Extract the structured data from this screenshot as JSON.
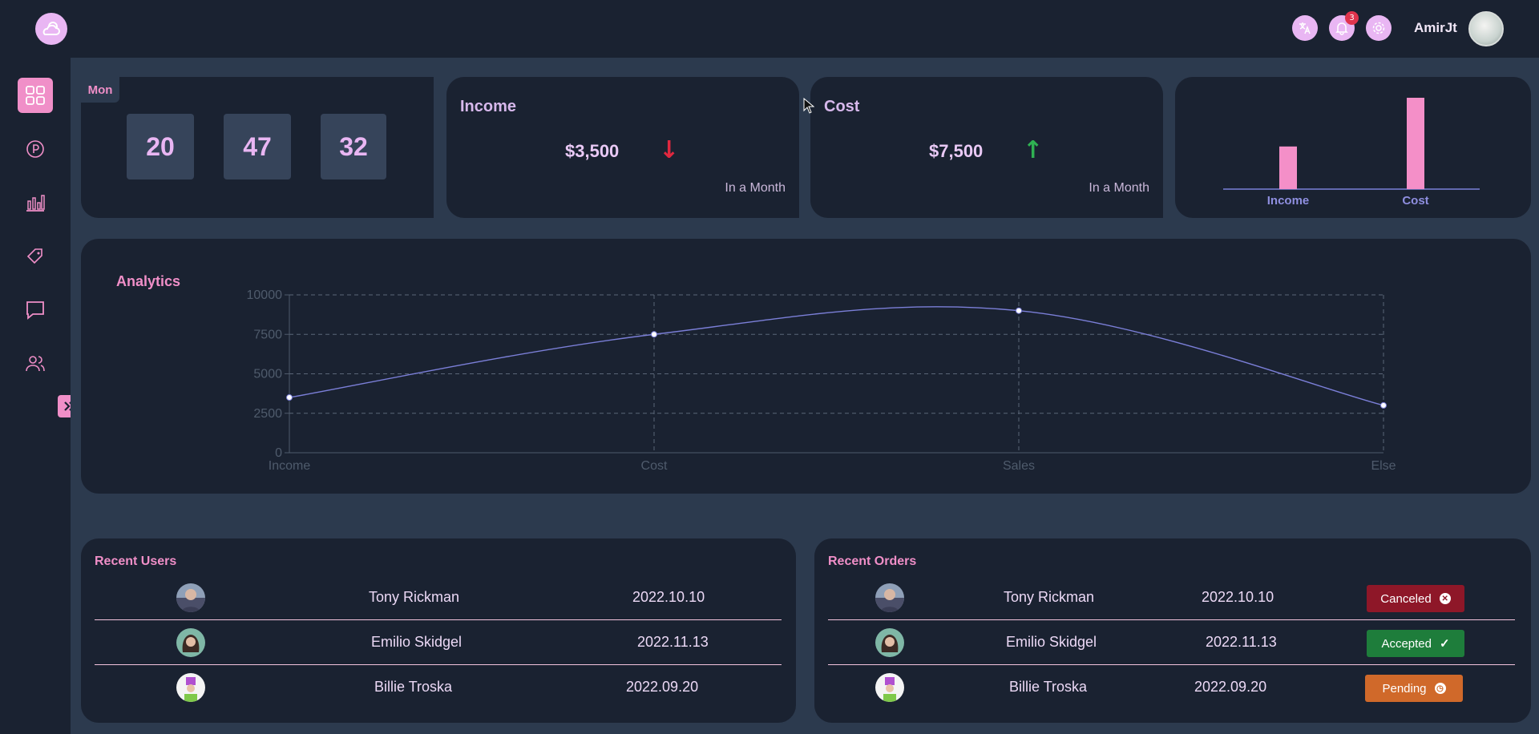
{
  "header": {
    "username": "AmirJt",
    "notification_count": "3",
    "icons": [
      "weather-logo-icon",
      "translate-icon",
      "bell-icon",
      "gear-icon"
    ]
  },
  "sidebar": {
    "items": [
      {
        "icon": "dashboard-grid-icon",
        "active": true
      },
      {
        "icon": "parking-icon",
        "active": false
      },
      {
        "icon": "bar-chart-icon",
        "active": false
      },
      {
        "icon": "tag-icon",
        "active": false
      },
      {
        "icon": "chat-icon",
        "active": false
      },
      {
        "icon": "users-icon",
        "active": false
      }
    ],
    "toggle_icon": "double-chevron-right-icon"
  },
  "clock": {
    "day": "Mon",
    "hours": "20",
    "minutes": "47",
    "seconds": "32"
  },
  "income_card": {
    "title": "Income",
    "amount": "$3,500",
    "trend": "down",
    "period": "In a Month"
  },
  "cost_card": {
    "title": "Cost",
    "amount": "$7,500",
    "trend": "up",
    "period": "In a Month"
  },
  "mini_chart": {
    "chart_data": {
      "type": "bar",
      "categories": [
        "Income",
        "Cost"
      ],
      "values": [
        3500,
        7500
      ],
      "ylim": [
        0,
        7500
      ],
      "title": "",
      "xlabel": "",
      "ylabel": ""
    }
  },
  "analytics": {
    "title": "Analytics",
    "chart_data": {
      "type": "line",
      "categories": [
        "Income",
        "Cost",
        "Sales",
        "Else"
      ],
      "values": [
        3500,
        7500,
        9000,
        3000
      ],
      "yticks": [
        0,
        2500,
        5000,
        7500,
        10000
      ],
      "ylim": [
        0,
        10000
      ],
      "grid": true,
      "title": "",
      "xlabel": "",
      "ylabel": ""
    }
  },
  "recent_users": {
    "title": "Recent Users",
    "rows": [
      {
        "name": "Tony Rickman",
        "date": "2022.10.10"
      },
      {
        "name": "Emilio Skidgel",
        "date": "2022.11.13"
      },
      {
        "name": "Billie Troska",
        "date": "2022.09.20"
      }
    ]
  },
  "recent_orders": {
    "title": "Recent Orders",
    "rows": [
      {
        "name": "Tony Rickman",
        "date": "2022.10.10",
        "status": "Canceled",
        "status_color": "#8e1728"
      },
      {
        "name": "Emilio Skidgel",
        "date": "2022.11.13",
        "status": "Accepted",
        "status_color": "#1e7d3b"
      },
      {
        "name": "Billie Troska",
        "date": "2022.09.20",
        "status": "Pending",
        "status_color": "#d0692a"
      }
    ]
  },
  "colors": {
    "accent": "#f08fc8",
    "lavender": "#e9b6f3",
    "line": "#7b7fd8",
    "down": "#e0283f",
    "up": "#2fb152"
  }
}
